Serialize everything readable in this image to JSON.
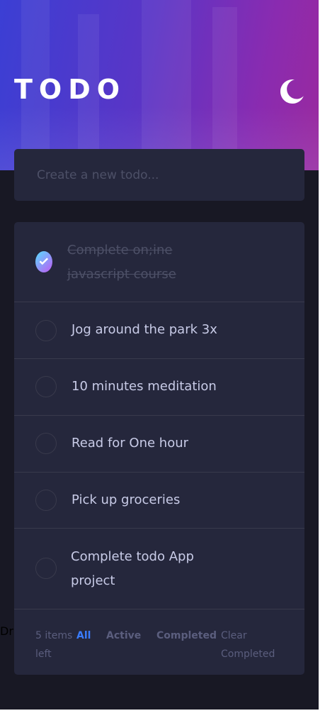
{
  "header": {
    "title": "TODO",
    "theme_toggle_icon": "moon-icon"
  },
  "new_todo": {
    "placeholder": "Create a new todo..."
  },
  "todos": [
    {
      "text": "Complete on;ine javascript course",
      "completed": true
    },
    {
      "text": "Jog around the park 3x",
      "completed": false
    },
    {
      "text": "10 minutes meditation",
      "completed": false
    },
    {
      "text": "Read for One hour",
      "completed": false
    },
    {
      "text": "Pick up groceries",
      "completed": false
    },
    {
      "text": "Complete todo App project",
      "completed": false
    }
  ],
  "footer": {
    "items_left": "5 items left",
    "filters": {
      "all": "All",
      "active": "Active",
      "completed": "Completed"
    },
    "active_filter": "All",
    "clear": "Clear Completed"
  },
  "side_note": "Dr",
  "colors": {
    "accent": "#3a7cfd",
    "page_bg": "#181824",
    "card_bg": "#25273c",
    "check_gradient_start": "#57ddff",
    "check_gradient_end": "#c058f3"
  }
}
